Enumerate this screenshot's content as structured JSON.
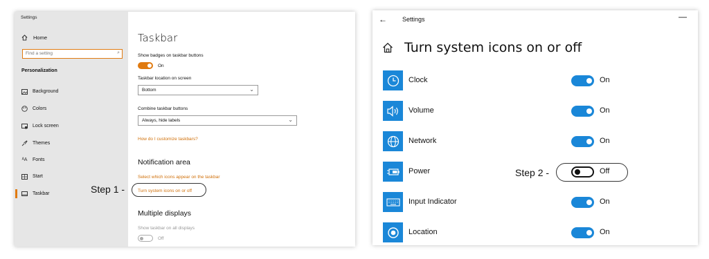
{
  "left_window": {
    "title": "Settings",
    "home_label": "Home",
    "search_placeholder": "Find a setting",
    "section_label": "Personalization",
    "nav_items": [
      {
        "label": "Background",
        "icon": "picture-icon"
      },
      {
        "label": "Colors",
        "icon": "palette-icon"
      },
      {
        "label": "Lock screen",
        "icon": "lock-screen-icon"
      },
      {
        "label": "Themes",
        "icon": "brush-icon"
      },
      {
        "label": "Fonts",
        "icon": "fonts-icon"
      },
      {
        "label": "Start",
        "icon": "start-icon"
      },
      {
        "label": "Taskbar",
        "icon": "taskbar-icon"
      }
    ],
    "page_title": "Taskbar",
    "show_badges_label": "Show badges on taskbar buttons",
    "show_badges_state": "On",
    "location_label": "Taskbar location on screen",
    "location_value": "Bottom",
    "combine_label": "Combine taskbar buttons",
    "combine_value": "Always, hide labels",
    "customize_link": "How do I customize taskbars?",
    "notification_heading": "Notification area",
    "select_icons_link": "Select which icons appear on the taskbar",
    "turn_icons_link": "Turn system icons on or off",
    "multiple_displays_heading": "Multiple displays",
    "show_all_displays_label": "Show taskbar on all displays",
    "show_all_displays_state": "Off"
  },
  "annotations": {
    "step1": "Step 1 -",
    "step2": "Step 2 -"
  },
  "right_window": {
    "title": "Settings",
    "back_glyph": "←",
    "minimize_glyph": "—",
    "page_title": "Turn system icons on or off",
    "items": [
      {
        "label": "Clock",
        "state": "On",
        "icon": "clock-icon"
      },
      {
        "label": "Volume",
        "state": "On",
        "icon": "volume-icon"
      },
      {
        "label": "Network",
        "state": "On",
        "icon": "globe-icon"
      },
      {
        "label": "Power",
        "state": "Off",
        "icon": "battery-icon"
      },
      {
        "label": "Input Indicator",
        "state": "On",
        "icon": "keyboard-icon"
      },
      {
        "label": "Location",
        "state": "On",
        "icon": "location-icon"
      }
    ]
  },
  "colors": {
    "accent_orange": "#e07a10",
    "accent_blue": "#1a87d8"
  }
}
